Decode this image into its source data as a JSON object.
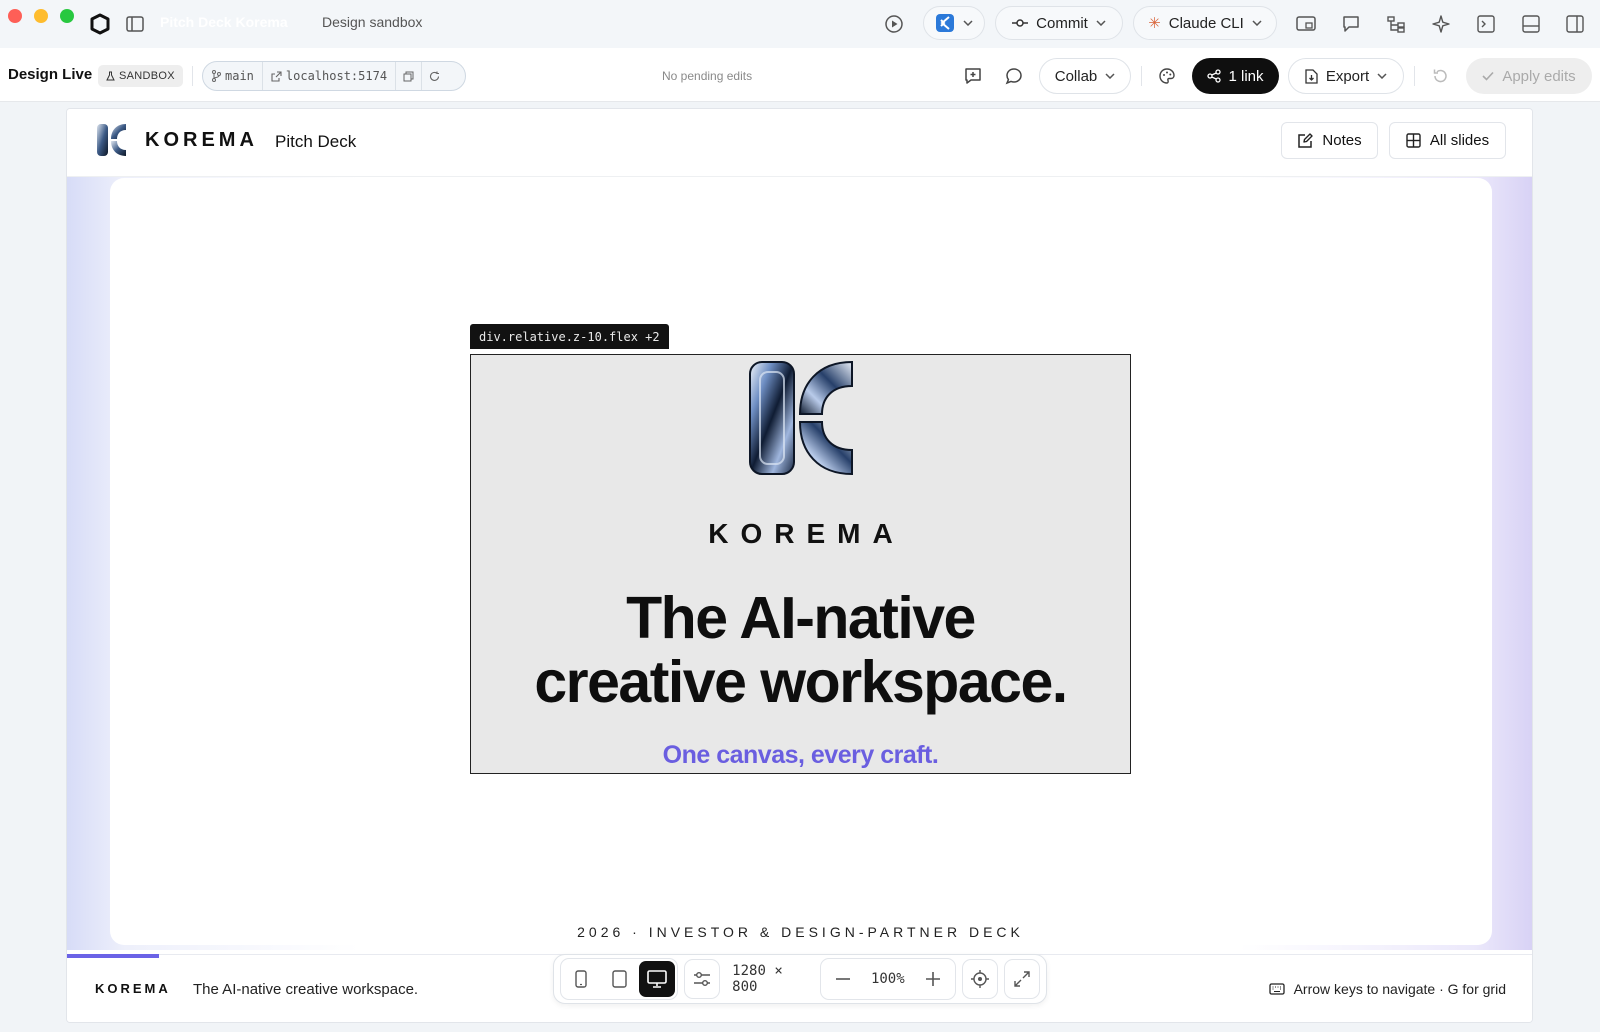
{
  "window": {
    "title": "Pitch Deck Korema",
    "subtitle": "Design sandbox"
  },
  "titlebar": {
    "commit_label": "Commit",
    "agent_label": "Claude CLI"
  },
  "toolbar": {
    "brand": "Design Live",
    "sandbox_badge": "SANDBOX",
    "branch": "main",
    "host": "localhost:5174",
    "status": "No pending edits",
    "collab_label": "Collab",
    "share_label": "1 link",
    "export_label": "Export",
    "apply_label": "Apply edits"
  },
  "app": {
    "logo_word": "KOREMA",
    "deck_title": "Pitch Deck",
    "notes_label": "Notes",
    "all_slides_label": "All slides"
  },
  "slide": {
    "selection_tag": "div.relative.z-10.flex +2",
    "word": "KOREMA",
    "headline_line1": "The AI-native",
    "headline_line2": "creative workspace.",
    "tagline": "One canvas, every craft.",
    "caption": "2026 · INVESTOR & DESIGN-PARTNER DECK",
    "progress_fraction": 0.0625
  },
  "footer": {
    "brand": "KOREMA",
    "tagline": "The AI-native creative workspace.",
    "hint": "Arrow keys to navigate · G for grid"
  },
  "device_bar": {
    "dimensions": "1280 × 800",
    "zoom": "100%"
  },
  "colors": {
    "accent": "#6a5ee0",
    "dark_button": "#0f0f0f",
    "traffic_red": "#fe5f57",
    "traffic_yellow": "#febc2e",
    "traffic_green": "#28c840"
  }
}
